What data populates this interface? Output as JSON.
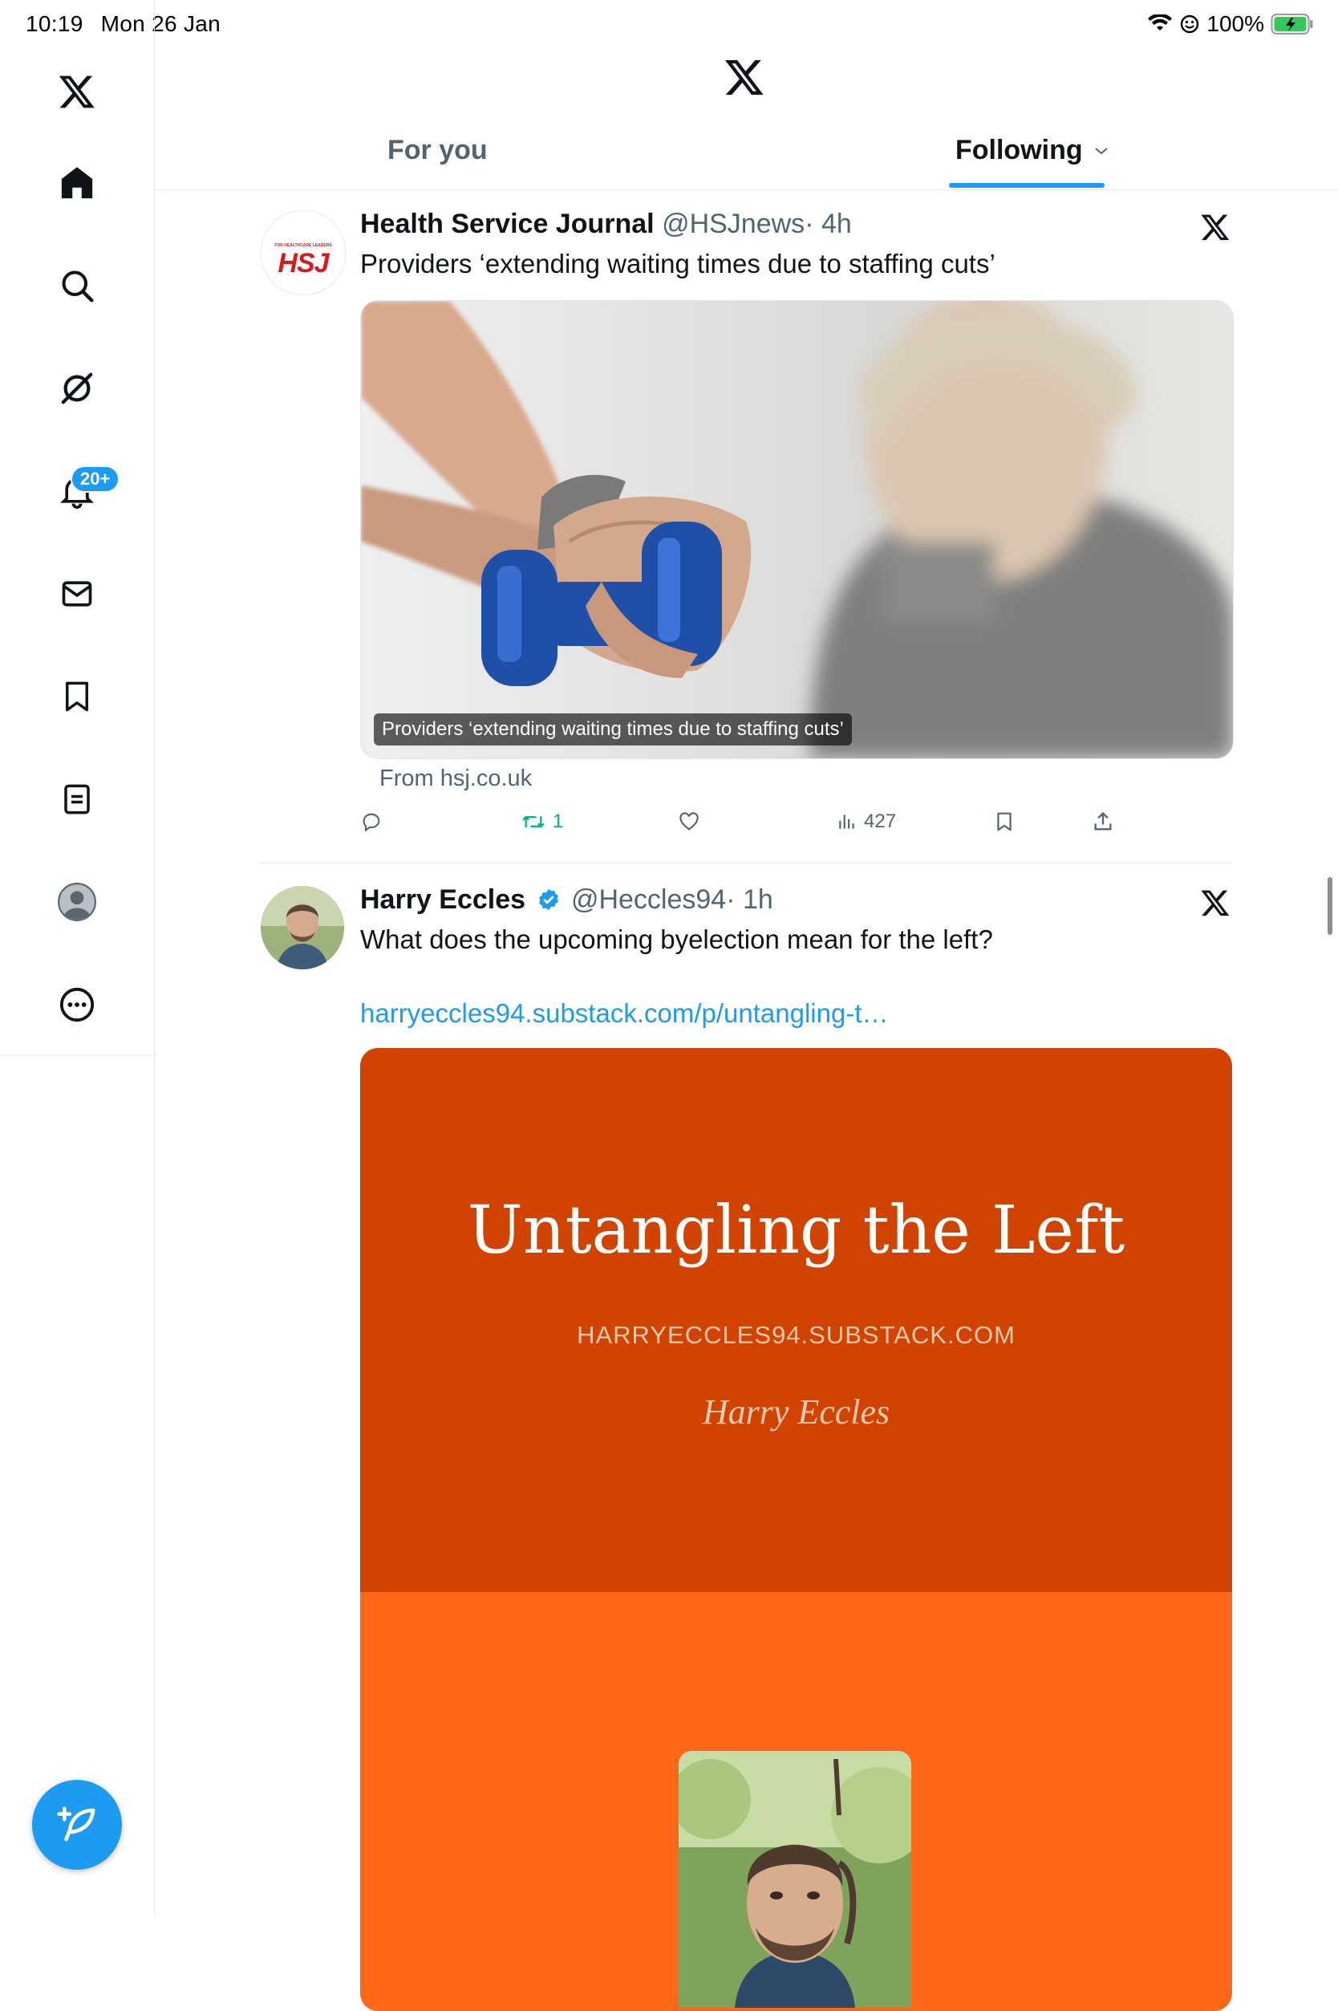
{
  "status_bar": {
    "time": "10:19",
    "date": "Mon 26 Jan",
    "battery": "100%"
  },
  "sidebar": {
    "items": [
      {
        "name": "x-logo-icon"
      },
      {
        "name": "home-icon"
      },
      {
        "name": "search-icon"
      },
      {
        "name": "grok-icon"
      },
      {
        "name": "notifications-icon"
      },
      {
        "name": "messages-icon"
      },
      {
        "name": "bookmarks-icon"
      },
      {
        "name": "lists-icon"
      },
      {
        "name": "profile-icon"
      },
      {
        "name": "more-icon"
      }
    ],
    "notifications_badge": "20+"
  },
  "header": {
    "tabs": [
      {
        "label": "For you",
        "active": false
      },
      {
        "label": "Following",
        "active": true
      }
    ]
  },
  "tweets": [
    {
      "name": "Health Service Journal",
      "handle": "@HSJnews",
      "time": "· 4h",
      "avatar_text": "HSJ",
      "avatar_small": "FOR HEALTHCARE LEADERS",
      "text": "Providers ‘extending waiting times due to staffing cuts’",
      "media_caption": "Providers ‘extending waiting times due to staffing cuts’",
      "from": "From hsj.co.uk",
      "actions": {
        "replies": "",
        "reposts": "1",
        "likes": "",
        "views": "427"
      }
    },
    {
      "name": "Harry Eccles",
      "handle": "@Heccles94",
      "time": "· 1h",
      "verified": true,
      "text": "What does the upcoming byelection mean for the left?",
      "link": "harryeccles94.substack.com/p/untangling-t…",
      "card": {
        "title": "Untangling the Left",
        "domain": "HARRYECCLES94.SUBSTACK.COM",
        "author": "Harry Eccles"
      }
    }
  ],
  "colors": {
    "accent": "#1d9bf0",
    "repost": "#00ba7c",
    "card_top": "#d14300",
    "card_bottom": "#ff6719"
  }
}
